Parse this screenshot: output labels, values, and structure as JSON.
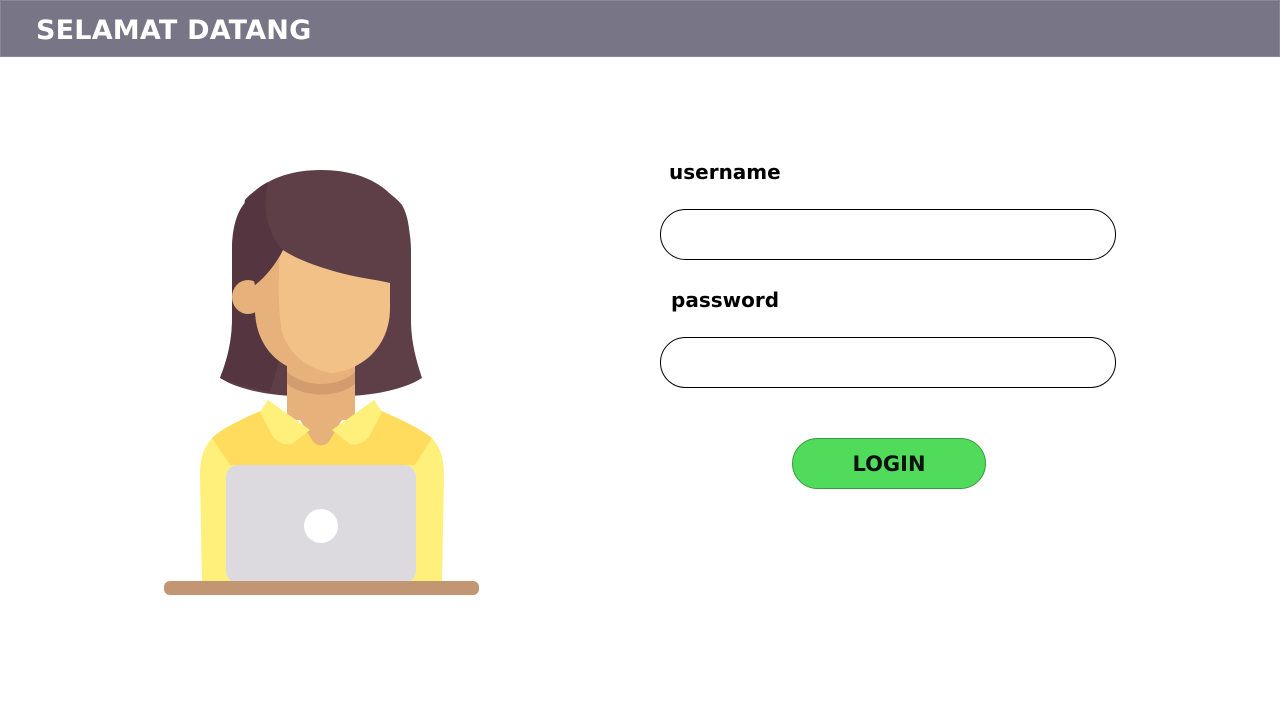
{
  "header": {
    "title": "SELAMAT DATANG"
  },
  "illustration": {
    "icon": "woman-with-laptop-icon"
  },
  "form": {
    "username_label": "username",
    "username_value": "",
    "password_label": "password",
    "password_value": "",
    "login_label": "LOGIN"
  },
  "colors": {
    "header_bg": "#777586",
    "login_button": "#50db5a"
  }
}
